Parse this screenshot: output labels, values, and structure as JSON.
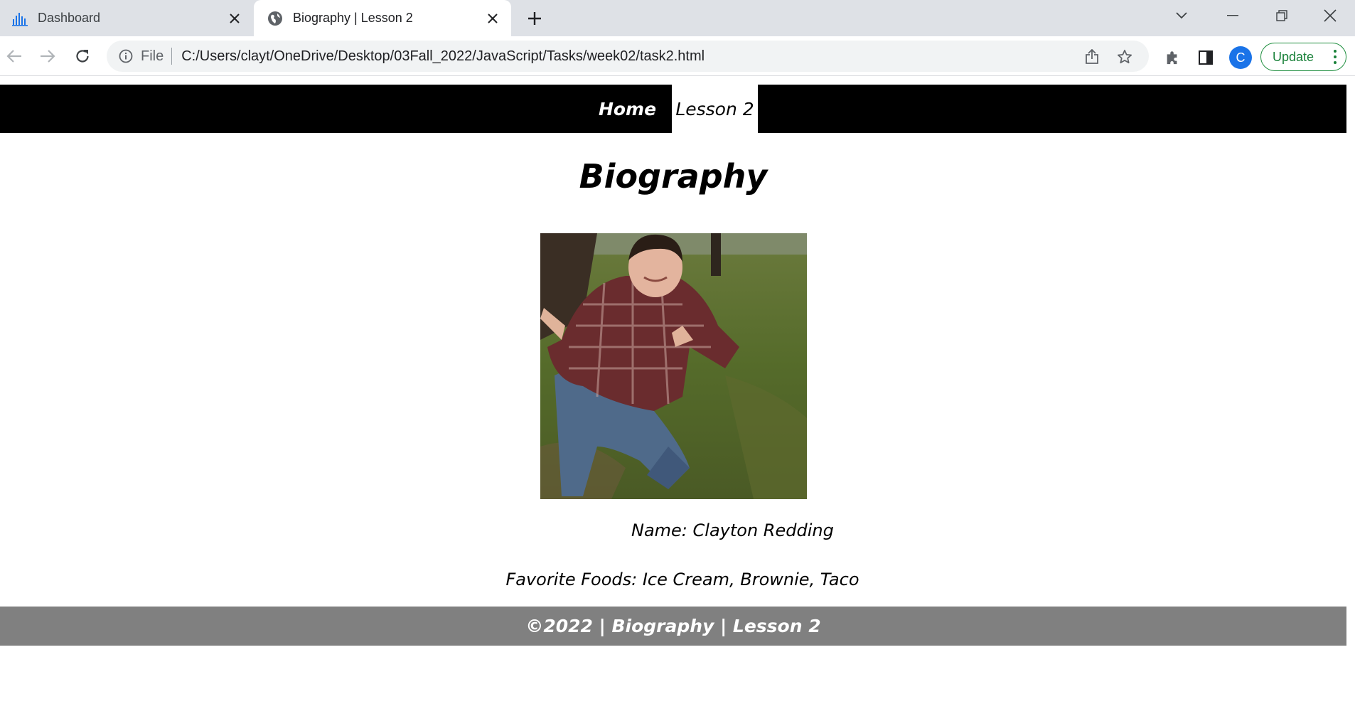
{
  "browser": {
    "tabs": [
      {
        "title": "Dashboard",
        "favicon": "bar-chart-icon",
        "active": false
      },
      {
        "title": "Biography | Lesson 2",
        "favicon": "globe-icon",
        "active": true
      }
    ],
    "omnibox": {
      "scheme_label": "File",
      "url": "C:/Users/clayt/OneDrive/Desktop/03Fall_2022/JavaScript/Tasks/week02/task2.html"
    },
    "profile_initial": "C",
    "update_label": "Update",
    "colors": {
      "accent": "#1a73e8",
      "update": "#188038",
      "tabstrip": "#dee1e6"
    }
  },
  "site": {
    "nav": {
      "home_label": "Home",
      "lesson_label": "Lesson 2"
    },
    "title": "Biography",
    "name_line": "Name: Clayton Redding",
    "foods_line": "Favorite Foods: Ice Cream, Brownie, Taco",
    "footer": "©2022 | Biography | Lesson 2",
    "colors": {
      "nav_bg": "#000000",
      "footer_bg": "#808080"
    }
  }
}
